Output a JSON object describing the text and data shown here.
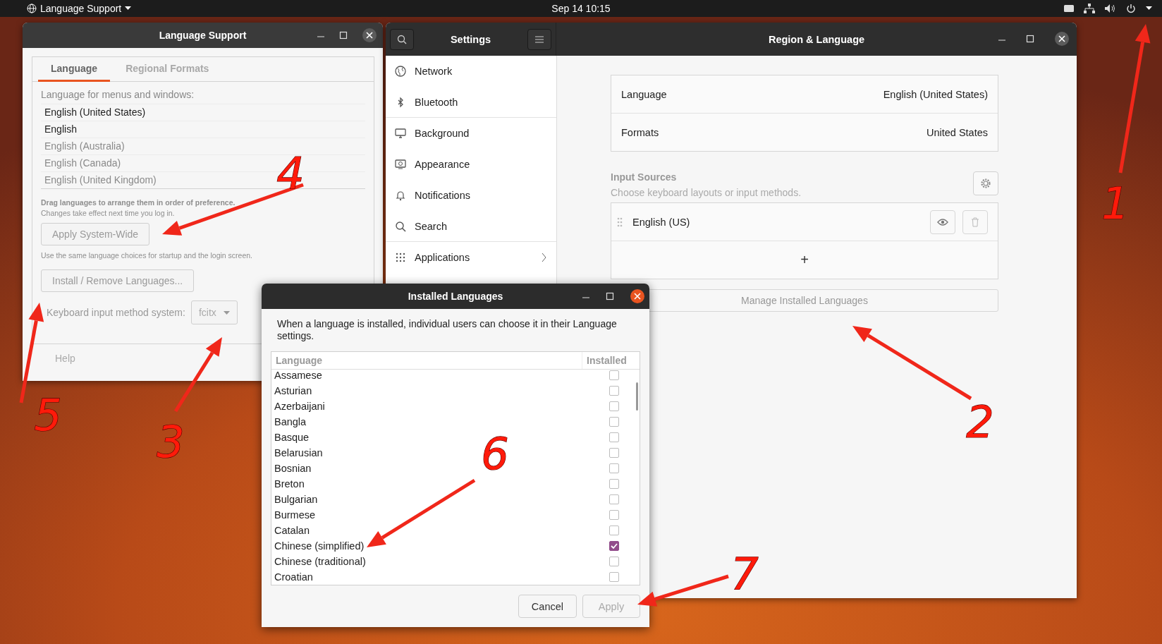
{
  "top_bar": {
    "app_menu": "Language Support",
    "clock": "Sep 14  10:15"
  },
  "language_support_window": {
    "title": "Language Support",
    "tabs": [
      {
        "label": "Language",
        "selected": true
      },
      {
        "label": "Regional Formats",
        "selected": false
      }
    ],
    "list_label": "Language for menus and windows:",
    "languages": [
      {
        "name": "English (United States)",
        "dimmed": false
      },
      {
        "name": "English",
        "dimmed": false
      },
      {
        "name": "English (Australia)",
        "dimmed": true
      },
      {
        "name": "English (Canada)",
        "dimmed": true
      },
      {
        "name": "English (United Kingdom)",
        "dimmed": true
      }
    ],
    "drag_hint": "Drag languages to arrange them in order of preference.",
    "changes_hint": "Changes take effect next time you log in.",
    "apply_button": "Apply System-Wide",
    "apply_hint": "Use the same language choices for startup and the login screen.",
    "install_button": "Install / Remove Languages...",
    "input_method_label": "Keyboard input method system:",
    "input_method": "fcitx",
    "help_button": "Help"
  },
  "settings_window": {
    "title": "Settings",
    "panel_title": "Region & Language",
    "sidebar": {
      "items": [
        {
          "label": "Network",
          "expandable": false
        },
        {
          "label": "Bluetooth",
          "expandable": false
        },
        {
          "label": "Background",
          "expandable": false
        },
        {
          "label": "Appearance",
          "expandable": false
        },
        {
          "label": "Notifications",
          "expandable": false
        },
        {
          "label": "Search",
          "expandable": false
        },
        {
          "label": "Applications",
          "expandable": true
        }
      ]
    },
    "region": {
      "rows": [
        {
          "label": "Language",
          "value": "English (United States)"
        },
        {
          "label": "Formats",
          "value": "United States"
        }
      ],
      "input_sources_title": "Input Sources",
      "input_sources_hint": "Choose keyboard layouts or input methods.",
      "sources": [
        {
          "name": "English (US)"
        }
      ],
      "add_button": "+",
      "manage_button": "Manage Installed Languages"
    }
  },
  "installed_languages_dialog": {
    "title": "Installed Languages",
    "description": "When a language is installed, individual users can choose it in their Language settings.",
    "columns": [
      "Language",
      "Installed"
    ],
    "rows": [
      {
        "language": "Assamese",
        "installed": false
      },
      {
        "language": "Asturian",
        "installed": false
      },
      {
        "language": "Azerbaijani",
        "installed": false
      },
      {
        "language": "Bangla",
        "installed": false
      },
      {
        "language": "Basque",
        "installed": false
      },
      {
        "language": "Belarusian",
        "installed": false
      },
      {
        "language": "Bosnian",
        "installed": false
      },
      {
        "language": "Breton",
        "installed": false
      },
      {
        "language": "Bulgarian",
        "installed": false
      },
      {
        "language": "Burmese",
        "installed": false
      },
      {
        "language": "Catalan",
        "installed": false
      },
      {
        "language": "Chinese (simplified)",
        "installed": true
      },
      {
        "language": "Chinese (traditional)",
        "installed": false
      },
      {
        "language": "Croatian",
        "installed": false
      }
    ],
    "buttons": [
      {
        "label": "Cancel",
        "disabled": false
      },
      {
        "label": "Apply",
        "disabled": true
      }
    ]
  },
  "annotations": [
    {
      "label": "1"
    },
    {
      "label": "2"
    },
    {
      "label": "3"
    },
    {
      "label": "4"
    },
    {
      "label": "5"
    },
    {
      "label": "6"
    },
    {
      "label": "7"
    }
  ]
}
